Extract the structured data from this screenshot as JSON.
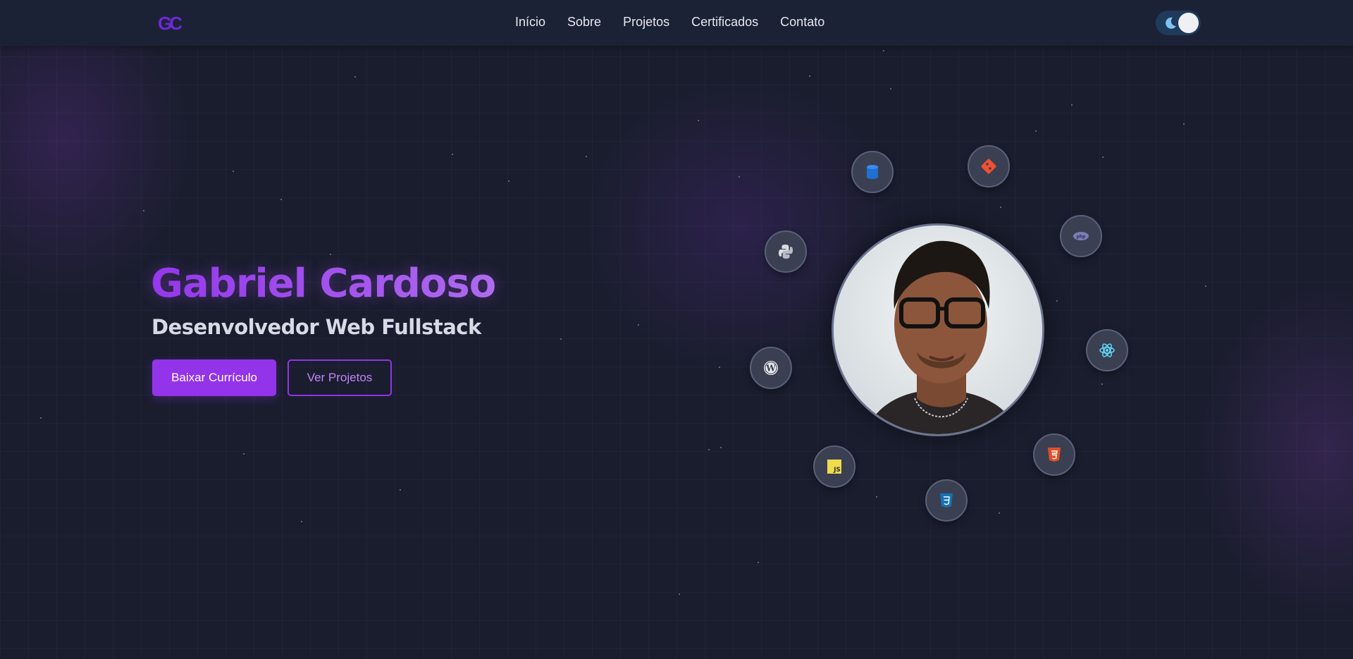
{
  "header": {
    "logo_text": "GC",
    "nav": [
      "Início",
      "Sobre",
      "Projetos",
      "Certificados",
      "Contato"
    ]
  },
  "hero": {
    "name": "Gabriel Cardoso",
    "role": "Desenvolvedor Web Fullstack",
    "primary_button": "Baixar Currículo",
    "secondary_button": "Ver Projetos"
  },
  "tech_icons": [
    "database-icon",
    "git-icon",
    "php-icon",
    "react-icon",
    "html5-icon",
    "css3-icon",
    "javascript-icon",
    "wordpress-icon",
    "python-icon"
  ],
  "colors": {
    "accent": "#9333ea",
    "accent_light": "#c084fc",
    "background": "#1a1d2e",
    "header": "#1c2235"
  }
}
